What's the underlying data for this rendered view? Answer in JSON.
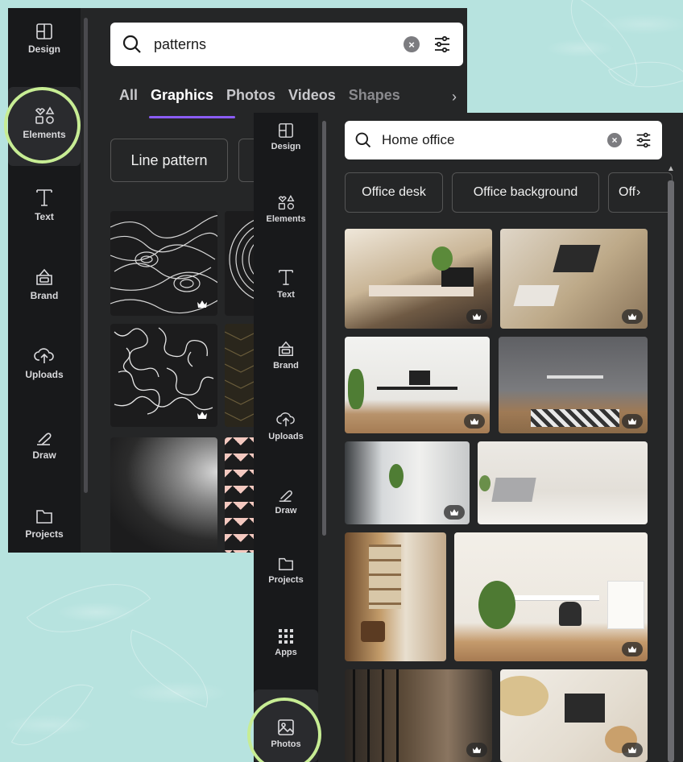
{
  "left_panel": {
    "rail": [
      {
        "label": "Design",
        "icon": "design-icon"
      },
      {
        "label": "Elements",
        "icon": "elements-icon"
      },
      {
        "label": "Text",
        "icon": "text-icon"
      },
      {
        "label": "Brand",
        "icon": "brand-icon"
      },
      {
        "label": "Uploads",
        "icon": "uploads-icon"
      },
      {
        "label": "Draw",
        "icon": "draw-icon"
      },
      {
        "label": "Projects",
        "icon": "projects-icon"
      }
    ],
    "active": "Elements",
    "search_value": "patterns",
    "tabs": [
      "All",
      "Graphics",
      "Photos",
      "Videos",
      "Shapes"
    ],
    "active_tab": "Graphics",
    "chips": [
      "Line pattern"
    ]
  },
  "right_panel": {
    "rail": [
      {
        "label": "Design",
        "icon": "design-icon"
      },
      {
        "label": "Elements",
        "icon": "elements-icon"
      },
      {
        "label": "Text",
        "icon": "text-icon"
      },
      {
        "label": "Brand",
        "icon": "brand-icon"
      },
      {
        "label": "Uploads",
        "icon": "uploads-icon"
      },
      {
        "label": "Draw",
        "icon": "draw-icon"
      },
      {
        "label": "Projects",
        "icon": "projects-icon"
      },
      {
        "label": "Apps",
        "icon": "apps-icon"
      },
      {
        "label": "Photos",
        "icon": "photos-icon"
      }
    ],
    "active": "Photos",
    "search_value": "Home office",
    "chips": [
      "Office desk",
      "Office background",
      "Off"
    ]
  },
  "colors": {
    "background": "#b7e3df",
    "panel": "#252627",
    "rail": "#18191b",
    "highlight_ring": "#c7ed94",
    "tab_underline": "#8b5cf6"
  }
}
